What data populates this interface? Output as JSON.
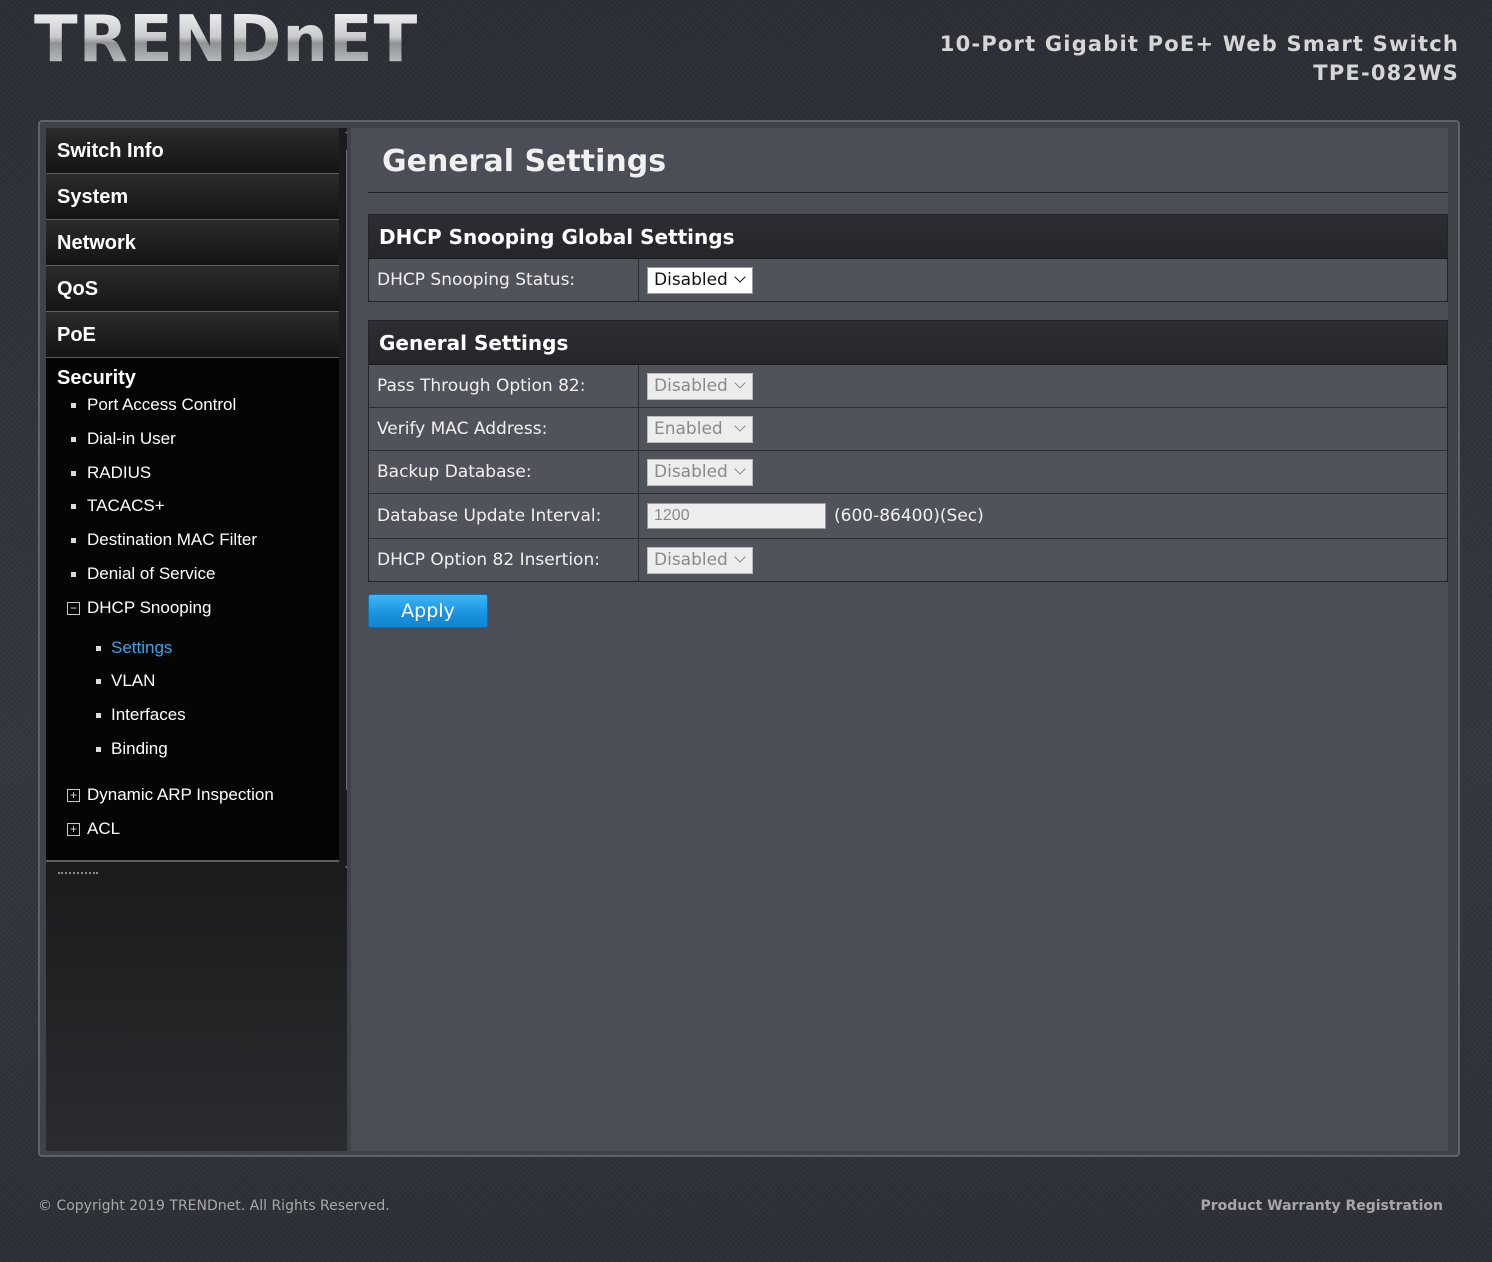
{
  "header": {
    "logo_text": "TRENDnET",
    "product_line1": "10-Port Gigabit PoE+ Web Smart Switch",
    "product_line2": "TPE-082WS"
  },
  "sidebar": {
    "menu": [
      {
        "label": "Switch Info"
      },
      {
        "label": "System"
      },
      {
        "label": "Network"
      },
      {
        "label": "QoS"
      },
      {
        "label": "PoE"
      }
    ],
    "security": {
      "label": "Security",
      "items": [
        {
          "label": "Port Access Control"
        },
        {
          "label": "Dial-in User"
        },
        {
          "label": "RADIUS"
        },
        {
          "label": "TACACS+"
        },
        {
          "label": "Destination MAC Filter"
        },
        {
          "label": "Denial of Service"
        }
      ],
      "dhcp_snooping": {
        "label": "DHCP Snooping",
        "expand_symbol": "−",
        "children": [
          {
            "label": "Settings",
            "active": true
          },
          {
            "label": "VLAN"
          },
          {
            "label": "Interfaces"
          },
          {
            "label": "Binding"
          }
        ]
      },
      "collapsed": [
        {
          "label": "Dynamic ARP Inspection",
          "expand_symbol": "+"
        },
        {
          "label": "ACL",
          "expand_symbol": "+"
        }
      ]
    }
  },
  "content": {
    "page_title": "General Settings",
    "global_section": {
      "title": "DHCP Snooping Global Settings",
      "status_label": "DHCP Snooping Status:",
      "status_value": "Disabled"
    },
    "general_section": {
      "title": "General Settings",
      "rows": [
        {
          "label": "Pass Through Option 82:",
          "value": "Disabled"
        },
        {
          "label": "Verify MAC Address:",
          "value": "Enabled"
        },
        {
          "label": "Backup Database:",
          "value": "Disabled"
        },
        {
          "label": "Database Update Interval:",
          "value": "1200",
          "hint": "(600-86400)(Sec)"
        },
        {
          "label": "DHCP Option 82 Insertion:",
          "value": "Disabled"
        }
      ]
    },
    "apply_label": "Apply"
  },
  "footer": {
    "copyright": "© Copyright 2019 TRENDnet. All Rights Reserved.",
    "warranty": "Product Warranty Registration"
  },
  "colors": {
    "accent_active": "#3aa6e8",
    "apply_button": "#1b93e0"
  }
}
